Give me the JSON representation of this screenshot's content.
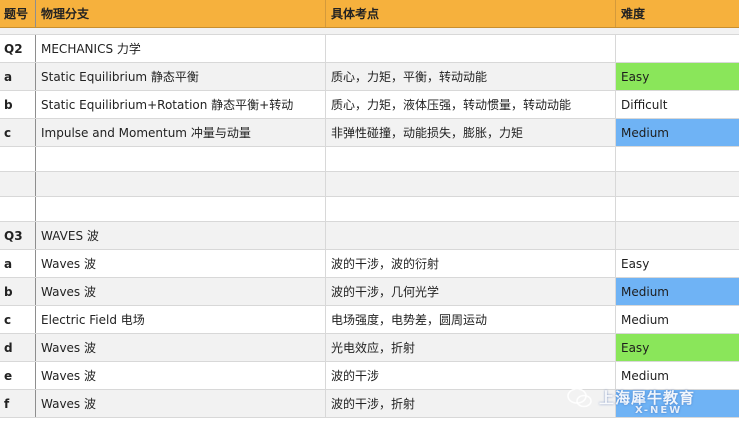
{
  "header": {
    "col1": "题号",
    "col2": "物理分支",
    "col3": "具体考点",
    "col4": "难度"
  },
  "rows": [
    {
      "num": "Q2",
      "branch": "MECHANICS 力学",
      "points": "",
      "level": ""
    },
    {
      "num": "a",
      "branch": "Static Equilibrium 静态平衡",
      "points": "质心，力矩，平衡，转动动能",
      "level": "Easy"
    },
    {
      "num": "b",
      "branch": "Static Equilibrium+Rotation 静态平衡+转动",
      "points": "质心，力矩，液体压强，转动惯量，转动动能",
      "level": "Difficult"
    },
    {
      "num": "c",
      "branch": "Impulse and Momentum 冲量与动量",
      "points": "非弹性碰撞，动能损失，膨胀，力矩",
      "level": "Medium"
    },
    {
      "num": "",
      "branch": "",
      "points": "",
      "level": ""
    },
    {
      "num": "",
      "branch": "",
      "points": "",
      "level": ""
    },
    {
      "num": "",
      "branch": "",
      "points": "",
      "level": ""
    },
    {
      "num": "Q3",
      "branch": "WAVES 波",
      "points": "",
      "level": ""
    },
    {
      "num": "a",
      "branch": "Waves 波",
      "points": "波的干涉，波的衍射",
      "level": "Easy"
    },
    {
      "num": "b",
      "branch": "Waves 波",
      "points": "波的干涉，几何光学",
      "level": "Medium"
    },
    {
      "num": "c",
      "branch": "Electric Field 电场",
      "points": "电场强度，电势差，圆周运动",
      "level": "Medium"
    },
    {
      "num": "d",
      "branch": "Waves 波",
      "points": "光电效应，折射",
      "level": "Easy"
    },
    {
      "num": "e",
      "branch": "Waves 波",
      "points": "波的干涉",
      "level": "Medium"
    },
    {
      "num": "f",
      "branch": "Waves 波",
      "points": "波的干涉，折射",
      "level": ""
    }
  ],
  "watermark": {
    "text": "上海犀牛教育",
    "sub": "X-NEW"
  },
  "colors": {
    "header": "#f6b13d",
    "easy": "#8ae65a",
    "medium": "#6fb3f5",
    "difficult": "#e23a2a"
  }
}
